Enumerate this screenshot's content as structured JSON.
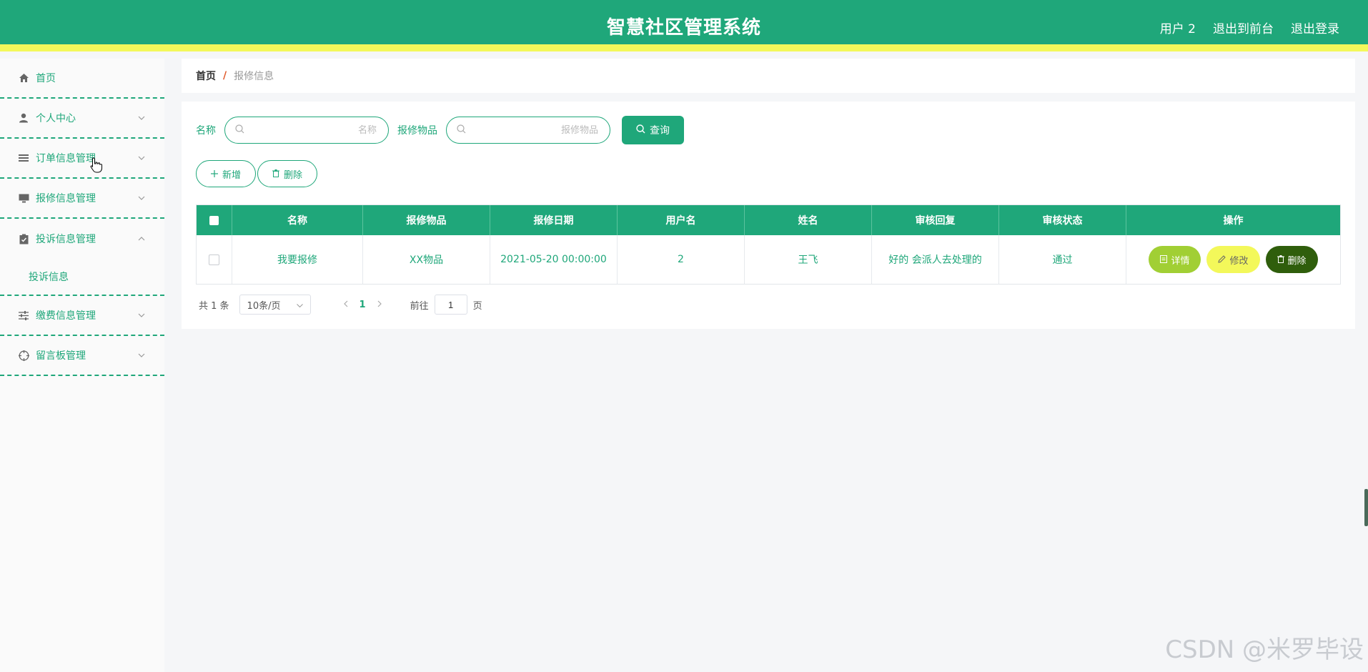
{
  "header": {
    "title": "智慧社区管理系统",
    "user": "用户 2",
    "back_front": "退出到前台",
    "logout": "退出登录"
  },
  "sidebar": {
    "items": [
      {
        "label": "首页",
        "icon": "home-icon"
      },
      {
        "label": "个人中心",
        "icon": "user-icon"
      },
      {
        "label": "订单信息管理",
        "icon": "list-icon"
      },
      {
        "label": "报修信息管理",
        "icon": "monitor-icon"
      },
      {
        "label": "投诉信息管理",
        "icon": "clipboard-icon",
        "expanded": true,
        "children": [
          {
            "label": "投诉信息"
          }
        ]
      },
      {
        "label": "缴费信息管理",
        "icon": "sliders-icon"
      },
      {
        "label": "留言板管理",
        "icon": "target-icon"
      }
    ]
  },
  "breadcrumb": {
    "home": "首页",
    "separator": "/",
    "current": "报修信息"
  },
  "search": {
    "name_label": "名称",
    "name_placeholder": "名称",
    "item_label": "报修物品",
    "item_placeholder": "报修物品",
    "query_button": "查询"
  },
  "actions": {
    "add": "新增",
    "delete": "删除"
  },
  "table": {
    "headers": [
      "名称",
      "报修物品",
      "报修日期",
      "用户名",
      "姓名",
      "审核回复",
      "审核状态",
      "操作"
    ],
    "rows": [
      {
        "name": "我要报修",
        "item": "XX物品",
        "date": "2021-05-20 00:00:00",
        "username": "2",
        "realname": "王飞",
        "reply": "好的 会派人去处理的",
        "status": "通过"
      }
    ],
    "row_actions": {
      "detail": "详情",
      "edit": "修改",
      "delete": "删除"
    }
  },
  "pagination": {
    "total": "共 1 条",
    "page_size": "10条/页",
    "current_page": "1",
    "goto_label": "前往",
    "goto_value": "1",
    "page_suffix": "页"
  },
  "watermark": "CSDN @米罗毕设",
  "colors": {
    "primary": "#1fa77a",
    "accent_yellow": "#f3f85a",
    "detail_btn": "#a1cf34",
    "delete_btn": "#2f5e0c"
  }
}
